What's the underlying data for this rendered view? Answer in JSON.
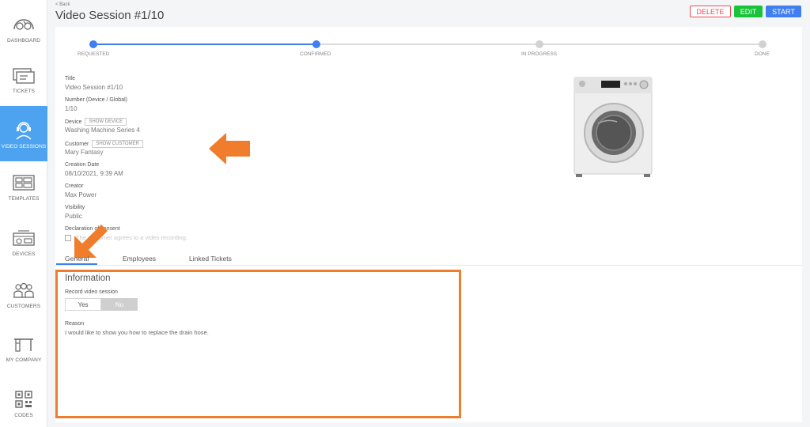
{
  "sidebar": {
    "items": [
      {
        "label": "DASHBOARD",
        "icon": "dashboard-icon",
        "active": false
      },
      {
        "label": "TICKETS",
        "icon": "tickets-icon",
        "active": false
      },
      {
        "label": "VIDEO SESSIONS",
        "icon": "headset-agent-icon",
        "active": true
      },
      {
        "label": "TEMPLATES",
        "icon": "templates-icon",
        "active": false
      },
      {
        "label": "DEVICES",
        "icon": "devices-icon",
        "active": false
      },
      {
        "label": "CUSTOMERS",
        "icon": "customers-icon",
        "active": false
      },
      {
        "label": "MY COMPANY",
        "icon": "company-desk-icon",
        "active": false
      },
      {
        "label": "CODES",
        "icon": "qr-code-icon",
        "active": false
      }
    ]
  },
  "header": {
    "back_label": "< Back",
    "title": "Video Session #1/10",
    "delete_label": "DELETE",
    "edit_label": "EDIT",
    "start_label": "START"
  },
  "progress": {
    "steps": [
      {
        "label": "REQUESTED",
        "done": true
      },
      {
        "label": "CONFIRMED",
        "done": true
      },
      {
        "label": "IN PROGRESS",
        "done": false
      },
      {
        "label": "DONE",
        "done": false
      }
    ]
  },
  "details": {
    "title_label": "Title",
    "title_value": "Video Session #1/10",
    "number_label": "Number (Device / Global)",
    "number_value": "1/10",
    "device_label": "Device",
    "show_device": "SHOW DEVICE",
    "device_value": "Washing Machine Series 4",
    "customer_label": "Customer",
    "show_customer": "SHOW CUSTOMER",
    "customer_value": "Mary Fantasy",
    "creation_label": "Creation Date",
    "creation_value": "08/10/2021, 9:39 AM",
    "creator_label": "Creator",
    "creator_value": "Max Power",
    "visibility_label": "Visibility",
    "visibility_value": "Public",
    "declaration_label": "Declaration of consent",
    "consent_text": "The customer agrees to a video recording."
  },
  "tabs": [
    "General",
    "Employees",
    "Linked Tickets"
  ],
  "information": {
    "title": "Information",
    "record_label": "Record video session",
    "yes": "Yes",
    "no": "No",
    "selected": "No",
    "reason_label": "Reason",
    "reason_value": "I would like to show you how to replace the drain hose."
  },
  "colors": {
    "accent": "#3f7ff0",
    "sidebar_active": "#4da3f0",
    "delete": "#e94b5b",
    "edit": "#1ac43a",
    "annotation": "#f07d2b"
  }
}
